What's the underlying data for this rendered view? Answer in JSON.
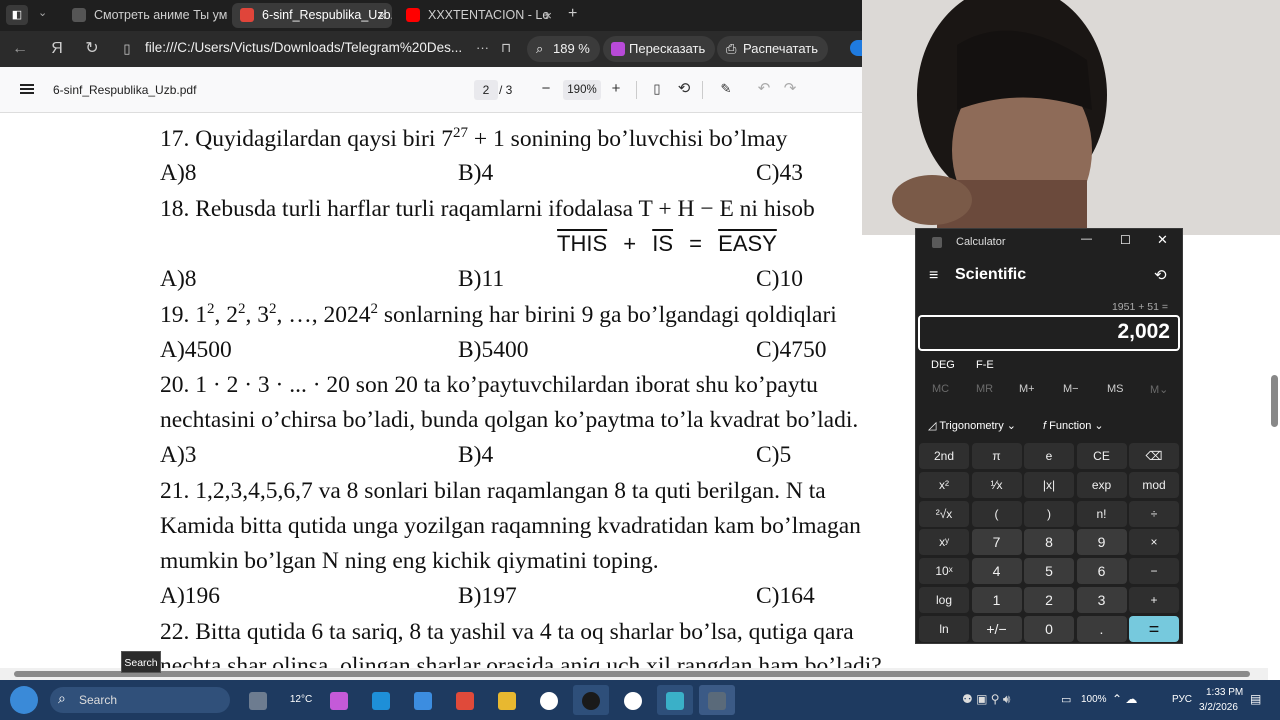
{
  "tabs": [
    {
      "label": "Смотреть аниме Ты умее",
      "close": ""
    },
    {
      "label": "6-sinf_Respublika_Uzb.p",
      "close": "×"
    },
    {
      "label": "XXXTENTACION - Le",
      "close": "×"
    }
  ],
  "address": {
    "url": "file:///C:/Users/Victus/Downloads/Telegram%20Des...",
    "more": "···",
    "zoom": "189 %",
    "retell": "Пересказать",
    "print": "Распечатать"
  },
  "pdf_toolbar": {
    "filename": "6-sinf_Respublika_Uzb.pdf",
    "page_current": "2",
    "page_total": "/ 3",
    "zoom": "190%",
    "zoom_out": "−",
    "zoom_in": "+"
  },
  "document": {
    "q17": "17. Quyidagilardan qaysi biri  7",
    "q17_exp": "27",
    "q17_rest": " + 1 sonininɡ bo’luvchisi bo’lmay",
    "q17_a": "A)8",
    "q17_b": "B)4",
    "q17_c": "C)43",
    "q18": "18. Rebusda turli harflar turli raqamlarni ifodalasa T + H − E ni hisob",
    "q18_this": "THIS",
    "q18_plus": "+",
    "q18_is": "IS",
    "q18_eq": "=",
    "q18_easy": "EASY",
    "q18_a": "A)8",
    "q18_b": "B)11",
    "q18_c": "C)10",
    "q19_pre": "19. 1",
    "q19_mid": ", 2",
    "q19_mid2": ", 3",
    "q19_mid3": ", …, 2024",
    "q19_sq": "2",
    "q19_rest": "  sonlarning har birini 9 ga bo’lgandagi qoldiqlari",
    "q19_a": "A)4500",
    "q19_b": "B)5400",
    "q19_c": "C)4750",
    "q20": "20. 1 · 2 · 3 · ... · 20  son  20  ta  ko’paytuvchilardan  iborat  shu  ko’paytu",
    "q20_line2": "nechtasini o’chirsa bo’ladi, bunda qolgan ko’paytma to’la kvadrat bo’ladi.",
    "q20_a": "A)3",
    "q20_b": "B)4",
    "q20_c": "C)5",
    "q21": "21. 1,2,3,4,5,6,7  va  8  sonlari  bilan  raqamlangan  8  ta  quti  berilgan.  N  ta",
    "q21_line2": "Kamida bitta qutida unga yozilgan raqamning kvadratidan kam bo’lmagan",
    "q21_line3": "mumkin bo’lgan N ning eng kichik qiymatini toping.",
    "q21_a": "A)196",
    "q21_b": "B)197",
    "q21_c": "C)164",
    "q22": "22. Bitta qutida 6 ta sariq, 8 ta yashil va 4 ta oq sharlar bo’lsa, qutiga qara",
    "q22_line2": "nechta shar olinsa, olingan sharlar orasida aniq uch xil rangdan ham bo’ladi?"
  },
  "calculator": {
    "title": "Calculator",
    "mode": "Scientific",
    "expression": "1951 + 51 =",
    "display": "2,002",
    "angle": "DEG",
    "fe": "F-E",
    "memory": [
      "MC",
      "MR",
      "M+",
      "M−",
      "MS",
      "M⌄"
    ],
    "trig": "Trigonometry",
    "func": "Function",
    "keys": [
      [
        "2nd",
        "π",
        "e",
        "CE",
        "⌫"
      ],
      [
        "x²",
        "¹⁄x",
        "|x|",
        "exp",
        "mod"
      ],
      [
        "²√x",
        "(",
        ")",
        "n!",
        "÷"
      ],
      [
        "xʸ",
        "7",
        "8",
        "9",
        "×"
      ],
      [
        "10ˣ",
        "4",
        "5",
        "6",
        "−"
      ],
      [
        "log",
        "1",
        "2",
        "3",
        "+"
      ],
      [
        "ln",
        "+/−",
        "0",
        ".",
        "="
      ]
    ]
  },
  "taskbar": {
    "search_label": "Search",
    "search_tooltip": "Search",
    "weather": "12°C",
    "battery": "100%",
    "lang": "РУС",
    "time": "1:33 PM",
    "date": "3/2/2026"
  }
}
